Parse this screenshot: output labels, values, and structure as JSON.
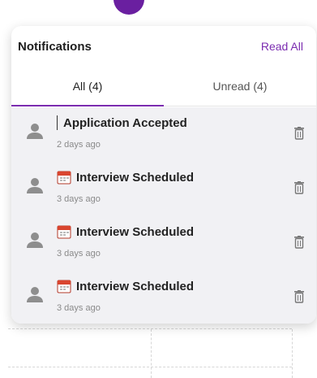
{
  "header": {
    "title": "Notifications",
    "read_all_label": "Read All"
  },
  "tabs": [
    {
      "label": "All (4)",
      "active": true
    },
    {
      "label": "Unread (4)",
      "active": false
    }
  ],
  "notifications": [
    {
      "title": "Application Accepted",
      "time": "2 days ago",
      "icon": "user-icon",
      "type_icon": null
    },
    {
      "title": "Interview Scheduled",
      "time": "3 days ago",
      "icon": "user-icon",
      "type_icon": "calendar-icon"
    },
    {
      "title": "Interview Scheduled",
      "time": "3 days ago",
      "icon": "user-icon",
      "type_icon": "calendar-icon"
    },
    {
      "title": "Interview Scheduled",
      "time": "3 days ago",
      "icon": "user-icon",
      "type_icon": "calendar-icon"
    }
  ],
  "colors": {
    "accent": "#7b2cb0",
    "list_background": "#f1f1f4",
    "avatar": "#6a1fa0"
  }
}
